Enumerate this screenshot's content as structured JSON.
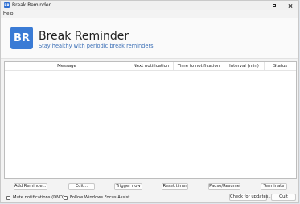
{
  "window": {
    "title": "Break Reminder"
  },
  "menu": {
    "help": "Help"
  },
  "header": {
    "logo_text": "BR",
    "title": "Break Reminder",
    "subtitle": "Stay healthy with periodic break reminders"
  },
  "table": {
    "columns": [
      "Message",
      "Next notification",
      "Time to notification",
      "Interval (min)",
      "Status"
    ],
    "rows": []
  },
  "buttons": {
    "add": "Add Reminder...",
    "edit": "Edit...",
    "trigger": "Trigger now",
    "reset": "Reset timer",
    "pause_resume": "Pause/Resume",
    "terminate": "Terminate",
    "check_updates": "Check for updates...",
    "quit": "Quit"
  },
  "options": {
    "mute": {
      "label": "Mute notifications (DND)",
      "checked": false
    },
    "focus_assist": {
      "label": "Follow Windows Focus Assist",
      "checked": false
    }
  },
  "colors": {
    "accent": "#3a7bd5",
    "subtitle": "#3b6fb6"
  }
}
